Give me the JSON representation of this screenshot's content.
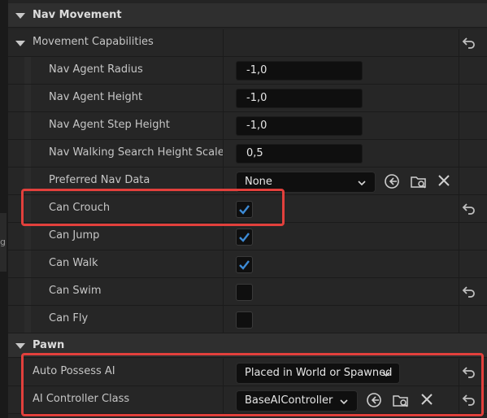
{
  "sections": {
    "nav_movement": "Nav Movement",
    "movement_capabilities": "Movement Capabilities",
    "pawn": "Pawn"
  },
  "props": {
    "nav_agent_radius": {
      "label": "Nav Agent Radius",
      "value": "-1,0"
    },
    "nav_agent_height": {
      "label": "Nav Agent Height",
      "value": "-1,0"
    },
    "nav_agent_step_height": {
      "label": "Nav Agent Step Height",
      "value": "-1,0"
    },
    "nav_walking_search_height_scale": {
      "label": "Nav Walking Search Height Scale",
      "value": "0,5"
    },
    "preferred_nav_data": {
      "label": "Preferred Nav Data",
      "value": "None"
    },
    "can_crouch": {
      "label": "Can Crouch",
      "checked": true
    },
    "can_jump": {
      "label": "Can Jump",
      "checked": true
    },
    "can_walk": {
      "label": "Can Walk",
      "checked": true
    },
    "can_swim": {
      "label": "Can Swim",
      "checked": false
    },
    "can_fly": {
      "label": "Can Fly",
      "checked": false
    },
    "auto_possess_ai": {
      "label": "Auto Possess AI",
      "value": "Placed in World or Spawned"
    },
    "ai_controller_class": {
      "label": "AI Controller Class",
      "value": "BaseAIController"
    }
  },
  "left_edge_glyph": "g",
  "icons": [
    "collapse-triangle-icon",
    "reset-to-default-icon",
    "chevron-down-icon",
    "use-selected-arrow-icon",
    "browse-folder-icon",
    "clear-x-icon",
    "checkmark-icon"
  ],
  "colors": {
    "accent_check": "#3d8bd6",
    "highlight_box": "#e2403c",
    "panel_bg": "#242424",
    "header_bg": "#2f2f2f",
    "field_bg": "#0f0f0f"
  }
}
